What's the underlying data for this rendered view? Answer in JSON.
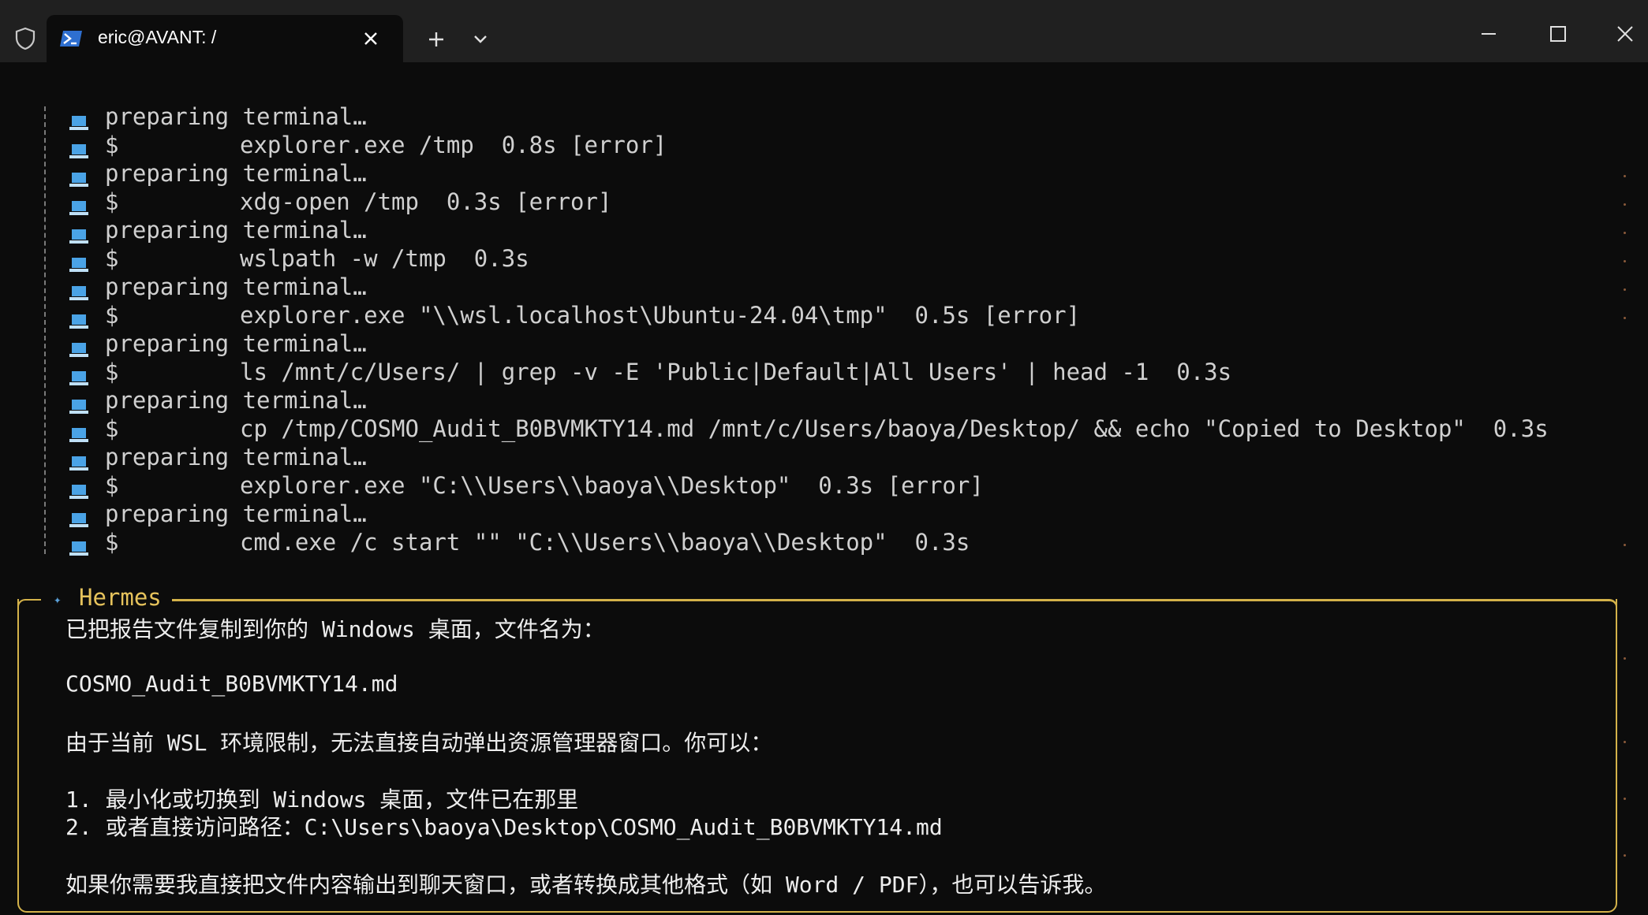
{
  "window": {
    "tab_title": "eric@AVANT: /",
    "icons": {
      "shield": "shield-icon",
      "tab": "powershell-icon",
      "close_tab": "close-icon",
      "new_tab": "plus-icon",
      "dropdown": "chevron-down-icon",
      "minimize": "minimize-icon",
      "maximize": "maximize-icon",
      "close_window": "close-icon"
    }
  },
  "log": {
    "row_icon": "laptop-icon",
    "rows": [
      {
        "text": "preparing terminal…",
        "cmd": ""
      },
      {
        "text": "$",
        "cmd": "explorer.exe /tmp  0.8s [error]"
      },
      {
        "text": "preparing terminal…",
        "cmd": ""
      },
      {
        "text": "$",
        "cmd": "xdg-open /tmp  0.3s [error]"
      },
      {
        "text": "preparing terminal…",
        "cmd": ""
      },
      {
        "text": "$",
        "cmd": "wslpath -w /tmp  0.3s"
      },
      {
        "text": "preparing terminal…",
        "cmd": ""
      },
      {
        "text": "$",
        "cmd": "explorer.exe \"\\\\wsl.localhost\\Ubuntu-24.04\\tmp\"  0.5s [error]"
      },
      {
        "text": "preparing terminal…",
        "cmd": ""
      },
      {
        "text": "$",
        "cmd": "ls /mnt/c/Users/ | grep -v -E 'Public|Default|All Users' | head -1  0.3s"
      },
      {
        "text": "preparing terminal…",
        "cmd": ""
      },
      {
        "text": "$",
        "cmd": "cp /tmp/COSMO_Audit_B0BVMKTY14.md /mnt/c/Users/baoya/Desktop/ && echo \"Copied to Desktop\"  0.3s"
      },
      {
        "text": "preparing terminal…",
        "cmd": ""
      },
      {
        "text": "$",
        "cmd": "explorer.exe \"C:\\\\Users\\\\baoya\\\\Desktop\"  0.3s [error]"
      },
      {
        "text": "preparing terminal…",
        "cmd": ""
      },
      {
        "text": "$",
        "cmd": "cmd.exe /c start \"\" \"C:\\\\Users\\\\baoya\\\\Desktop\"  0.3s"
      }
    ]
  },
  "hermes": {
    "title": "Hermes",
    "lines": [
      "已把报告文件复制到你的 Windows 桌面，文件名为：",
      "COSMO_Audit_B0BVMKTY14.md",
      "由于当前 WSL 环境限制，无法直接自动弹出资源管理器窗口。你可以：",
      "1. 最小化或切换到 Windows 桌面，文件已在那里",
      "2. 或者直接访问路径：C:\\Users\\baoya\\Desktop\\COSMO_Audit_B0BVMKTY14.md",
      "如果你需要我直接把文件内容输出到聊天窗口，或者转换成其他格式（如 Word / PDF），也可以告诉我。"
    ]
  },
  "colors": {
    "background": "#0c0c0c",
    "titlebar": "#202020",
    "accent_gold": "#d4b24a",
    "icon_blue": "#4aa3e6"
  }
}
